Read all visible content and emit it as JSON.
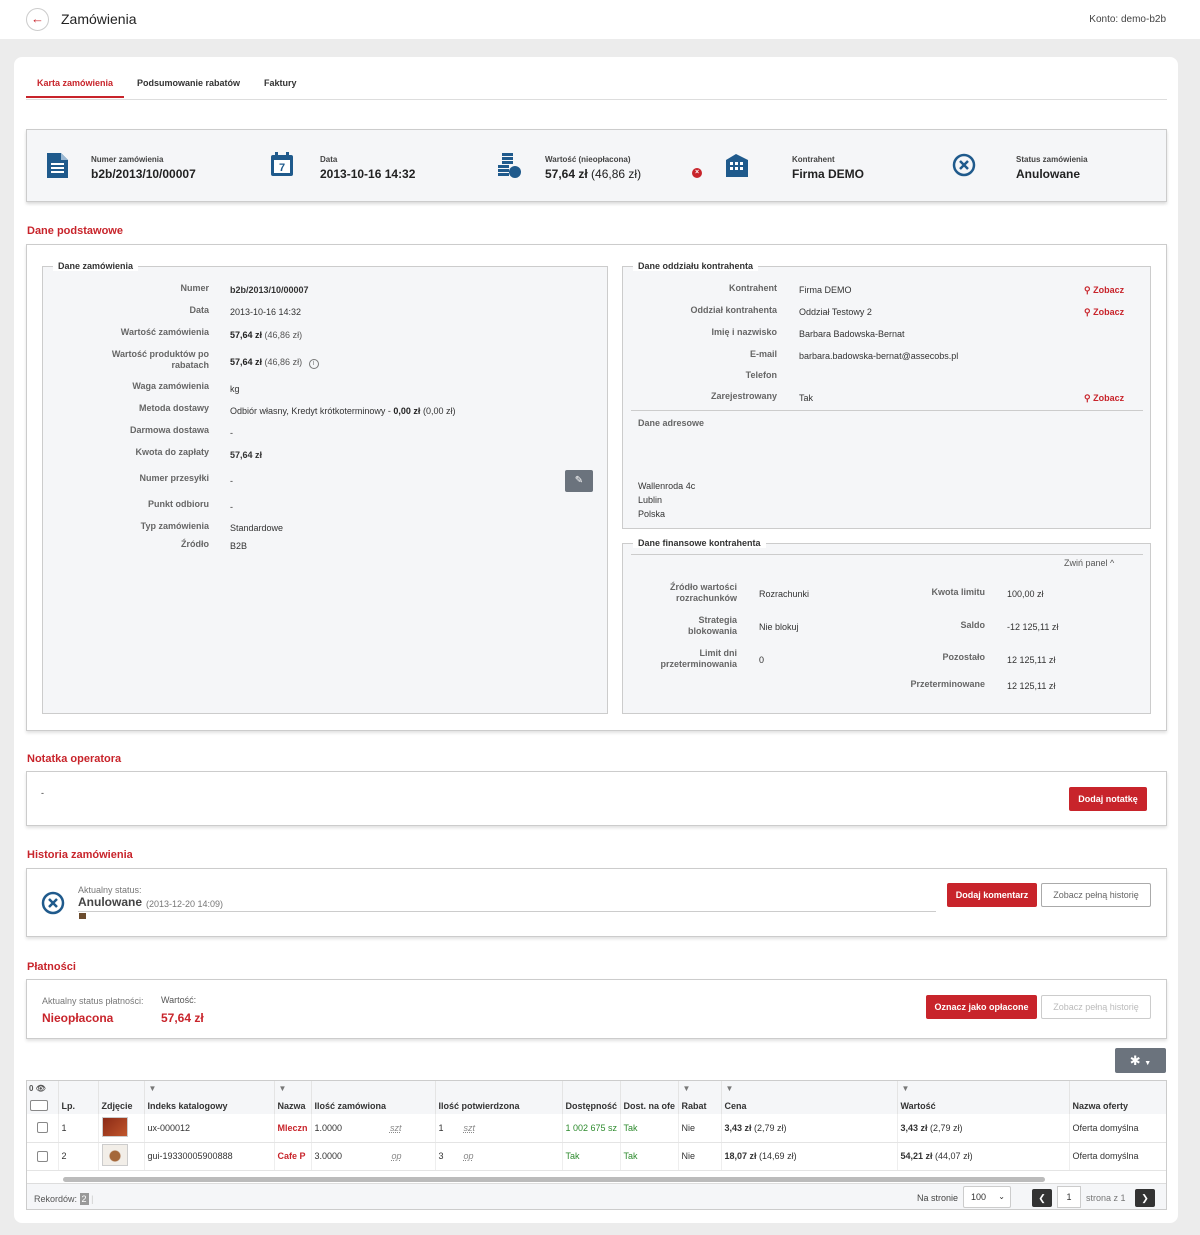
{
  "header": {
    "title": "Zamówienia",
    "account": "Konto: demo-b2b"
  },
  "tabs": [
    {
      "label": "Karta zamówienia",
      "active": true
    },
    {
      "label": "Podsumowanie rabatów",
      "active": false
    },
    {
      "label": "Faktury",
      "active": false
    }
  ],
  "summary": {
    "number_label": "Numer zamówienia",
    "number_value": "b2b/2013/10/00007",
    "date_label": "Data",
    "date_value": "2013-10-16 14:32",
    "value_label": "Wartość (nieopłacona)",
    "value_value": "57,64 zł",
    "value_gross": "(46,86 zł)",
    "contractor_label": "Kontrahent",
    "contractor_value": "Firma DEMO",
    "status_label": "Status zamówienia",
    "status_value": "Anulowane",
    "date_icon_day": "7"
  },
  "basic": {
    "section_title": "Dane podstawowe",
    "order": {
      "legend": "Dane zamówienia",
      "numer_label": "Numer",
      "numer_value": "b2b/2013/10/00007",
      "data_label": "Data",
      "data_value": "2013-10-16 14:32",
      "wartosc_label": "Wartość zamówienia",
      "wartosc_value": "57,64 zł",
      "wartosc_gross": "(46,86 zł)",
      "wartosc_prod_label_1": "Wartość produktów po",
      "wartosc_prod_label_2": "rabatach",
      "wartosc_prod_value": "57,64 zł",
      "wartosc_prod_gross": "(46,86 zł)",
      "waga_label": "Waga zamówienia",
      "waga_value": "kg",
      "metoda_label": "Metoda dostawy",
      "metoda_value": "Odbiór własny, Kredyt krótkoterminowy -",
      "metoda_price": "0,00 zł",
      "metoda_gross": "(0,00 zł)",
      "darmowa_label": "Darmowa dostawa",
      "darmowa_value": "-",
      "kwota_label": "Kwota do zapłaty",
      "kwota_value": "57,64 zł",
      "przesylka_label": "Numer przesyłki",
      "przesylka_value": "-",
      "punkt_label": "Punkt odbioru",
      "punkt_value": "-",
      "typ_label": "Typ zamówienia",
      "typ_value": "Standardowe",
      "zrodlo_label": "Źródło",
      "zrodlo_value": "B2B"
    },
    "branch": {
      "legend": "Dane oddziału kontrahenta",
      "kontrahent_label": "Kontrahent",
      "kontrahent_value": "Firma DEMO",
      "oddzial_label": "Oddział kontrahenta",
      "oddzial_value": "Oddział Testowy 2",
      "imie_label": "Imię i nazwisko",
      "imie_value": "Barbara Badowska-Bernat",
      "email_label": "E-mail",
      "email_value": "barbara.badowska-bernat@assecobs.pl",
      "telefon_label": "Telefon",
      "telefon_value": "",
      "zarejestrowany_label": "Zarejestrowany",
      "zarejestrowany_value": "Tak",
      "see_label": "Zobacz",
      "address_title": "Dane adresowe",
      "address_line1": "Wallenroda 4c",
      "address_line2": "Lublin",
      "address_line3": "Polska"
    },
    "finance": {
      "legend": "Dane finansowe kontrahenta",
      "collapse_label": "Zwiń panel ^",
      "zrodlo_label_1": "Źródło wartości",
      "zrodlo_label_2": "rozrachunków",
      "zrodlo_value": "Rozrachunki",
      "strategia_label_1": "Strategia",
      "strategia_label_2": "blokowania",
      "strategia_value": "Nie blokuj",
      "limit_label_1": "Limit dni",
      "limit_label_2": "przeterminowania",
      "limit_value": "0",
      "kwota_label": "Kwota limitu",
      "kwota_value": "100,00 zł",
      "saldo_label": "Saldo",
      "saldo_value": "-12 125,11 zł",
      "pozostalo_label": "Pozostało",
      "pozostalo_value": "12 125,11 zł",
      "przeterm_label": "Przeterminowane",
      "przeterm_value": "12 125,11 zł"
    }
  },
  "note": {
    "section_title": "Notatka operatora",
    "text": "-",
    "add_label": "Dodaj notatkę"
  },
  "history": {
    "section_title": "Historia zamówienia",
    "current_label": "Aktualny status:",
    "status": "Anulowane",
    "status_date": "(2013-12-20 14:09)",
    "add_comment_label": "Dodaj komentarz",
    "full_history_label": "Zobacz pełną historię"
  },
  "payments": {
    "section_title": "Płatności",
    "status_label": "Aktualny status płatności:",
    "status_value": "Nieopłacona",
    "value_label": "Wartość:",
    "value_value": "57,64 zł",
    "mark_paid_label": "Oznacz jako opłacone",
    "full_history_label": "Zobacz pełną historię"
  },
  "table": {
    "hidden_count": "0",
    "columns": [
      "Lp.",
      "Zdjęcie",
      "Indeks katalogowy",
      "Nazwa",
      "Ilość zamówiona",
      "Ilość potwierdzona",
      "Dostępność",
      "Dost. na ofe",
      "Rabat",
      "Cena",
      "Wartość",
      "Nazwa oferty"
    ],
    "rows": [
      {
        "lp": "1",
        "index": "ux-000012",
        "name": "Mleczn",
        "qty": "1.0000",
        "qty_unit": "szt",
        "conf": "1",
        "conf_unit": "szt",
        "avail": "1 002 675 sz",
        "dost": "Tak",
        "rabat": "Nie",
        "price": "3,43 zł",
        "price_gross": "(2,79 zł)",
        "value": "3,43 zł",
        "value_gross": "(2,79 zł)",
        "offer": "Oferta domyślna"
      },
      {
        "lp": "2",
        "index": "gui-19330005900888",
        "name": "Cafe P",
        "qty": "3.0000",
        "qty_unit": "op",
        "conf": "3",
        "conf_unit": "op",
        "avail": "Tak",
        "dost": "Tak",
        "rabat": "Nie",
        "price": "18,07 zł",
        "price_gross": "(14,69 zł)",
        "value": "54,21 zł",
        "value_gross": "(44,07 zł)",
        "offer": "Oferta domyślna"
      }
    ],
    "records_label": "Rekordów:",
    "records_count": "2",
    "per_page_label": "Na stronie",
    "per_page_value": "100",
    "page_value": "1",
    "page_of": "strona z 1"
  },
  "colors": {
    "accent": "#c8242b",
    "icon_blue": "#1f5a8c"
  }
}
